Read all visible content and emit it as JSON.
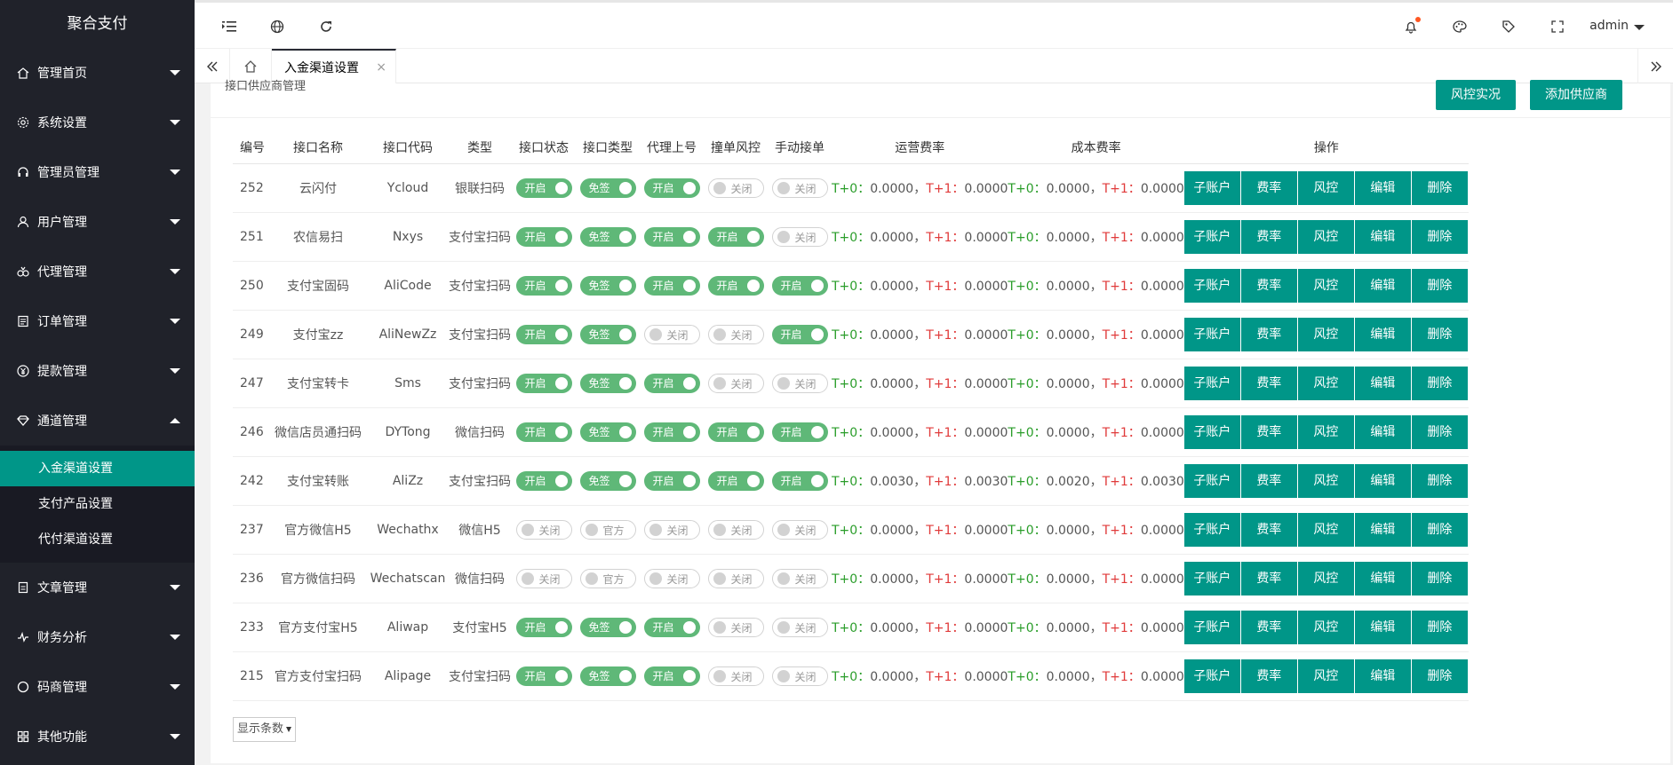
{
  "app": {
    "title": "聚合支付"
  },
  "sidebar": {
    "items": [
      {
        "label": "管理首页",
        "icon": "home-icon"
      },
      {
        "label": "系统设置",
        "icon": "gear-icon"
      },
      {
        "label": "管理员管理",
        "icon": "headset-icon"
      },
      {
        "label": "用户管理",
        "icon": "user-icon"
      },
      {
        "label": "代理管理",
        "icon": "agent-icon"
      },
      {
        "label": "订单管理",
        "icon": "list-icon"
      },
      {
        "label": "提款管理",
        "icon": "yen-icon"
      },
      {
        "label": "通道管理",
        "icon": "diamond-icon",
        "expanded": true
      }
    ],
    "sub_items": [
      {
        "label": "入金渠道设置",
        "active": true
      },
      {
        "label": "支付产品设置"
      },
      {
        "label": "代付渠道设置"
      }
    ],
    "items_after": [
      {
        "label": "文章管理",
        "icon": "doc-icon"
      },
      {
        "label": "财务分析",
        "icon": "pulse-icon"
      },
      {
        "label": "码商管理",
        "icon": "circle-icon"
      },
      {
        "label": "其他功能",
        "icon": "apps-icon"
      }
    ]
  },
  "header": {
    "user": "admin"
  },
  "tabs": {
    "active": "入金渠道设置",
    "close": "×"
  },
  "panel": {
    "title": "接口供应商管理",
    "risk_button": "风控实况",
    "add_button": "添加供应商"
  },
  "table": {
    "columns": [
      "编号",
      "接口名称",
      "接口代码",
      "类型",
      "接口状态",
      "接口类型",
      "代理上号",
      "撞单风控",
      "手动接单",
      "运营费率",
      "成本费率",
      "操作"
    ],
    "ops": [
      "子账户",
      "费率",
      "风控",
      "编辑",
      "删除"
    ],
    "on_label": "开启",
    "off_label": "关闭",
    "free_label": "免签",
    "official_label": "官方",
    "t0": "T+0：",
    "t1": "T+1：",
    "sep": "，",
    "rows": [
      {
        "id": "252",
        "name": "云闪付",
        "code": "Ycloud",
        "type": "银联扫码",
        "status": true,
        "itype": "免签",
        "agent": true,
        "risk": false,
        "manual": false,
        "op_t0": "0.0000",
        "op_t1": "0.0000",
        "cost_t0": "0.0000",
        "cost_t1": "0.0000"
      },
      {
        "id": "251",
        "name": "农信易扫",
        "code": "Nxys",
        "type": "支付宝扫码",
        "status": true,
        "itype": "免签",
        "agent": true,
        "risk": true,
        "manual": false,
        "op_t0": "0.0000",
        "op_t1": "0.0000",
        "cost_t0": "0.0000",
        "cost_t1": "0.0000"
      },
      {
        "id": "250",
        "name": "支付宝固码",
        "code": "AliCode",
        "type": "支付宝扫码",
        "status": true,
        "itype": "免签",
        "agent": true,
        "risk": true,
        "manual": true,
        "op_t0": "0.0000",
        "op_t1": "0.0000",
        "cost_t0": "0.0000",
        "cost_t1": "0.0000"
      },
      {
        "id": "249",
        "name": "支付宝zz",
        "code": "AliNewZz",
        "type": "支付宝扫码",
        "status": true,
        "itype": "免签",
        "agent": false,
        "risk": false,
        "manual": true,
        "op_t0": "0.0000",
        "op_t1": "0.0000",
        "cost_t0": "0.0000",
        "cost_t1": "0.0000"
      },
      {
        "id": "247",
        "name": "支付宝转卡",
        "code": "Sms",
        "type": "支付宝扫码",
        "status": true,
        "itype": "免签",
        "agent": true,
        "risk": false,
        "manual": false,
        "op_t0": "0.0000",
        "op_t1": "0.0000",
        "cost_t0": "0.0000",
        "cost_t1": "0.0000"
      },
      {
        "id": "246",
        "name": "微信店员通扫码",
        "code": "DYTong",
        "type": "微信扫码",
        "status": true,
        "itype": "免签",
        "agent": true,
        "risk": true,
        "manual": true,
        "op_t0": "0.0000",
        "op_t1": "0.0000",
        "cost_t0": "0.0000",
        "cost_t1": "0.0000"
      },
      {
        "id": "242",
        "name": "支付宝转账",
        "code": "AliZz",
        "type": "支付宝扫码",
        "status": true,
        "itype": "免签",
        "agent": true,
        "risk": true,
        "manual": true,
        "op_t0": "0.0030",
        "op_t1": "0.0030",
        "cost_t0": "0.0020",
        "cost_t1": "0.0030"
      },
      {
        "id": "237",
        "name": "官方微信H5",
        "code": "Wechathx",
        "type": "微信H5",
        "status": false,
        "itype": "官方",
        "agent": false,
        "risk": false,
        "manual": false,
        "op_t0": "0.0000",
        "op_t1": "0.0000",
        "cost_t0": "0.0000",
        "cost_t1": "0.0000"
      },
      {
        "id": "236",
        "name": "官方微信扫码",
        "code": "Wechatscan",
        "type": "微信扫码",
        "status": false,
        "itype": "官方",
        "agent": false,
        "risk": false,
        "manual": false,
        "op_t0": "0.0000",
        "op_t1": "0.0000",
        "cost_t0": "0.0000",
        "cost_t1": "0.0000"
      },
      {
        "id": "233",
        "name": "官方支付宝H5",
        "code": "Aliwap",
        "type": "支付宝H5",
        "status": true,
        "itype": "免签",
        "agent": true,
        "risk": false,
        "manual": false,
        "op_t0": "0.0000",
        "op_t1": "0.0000",
        "cost_t0": "0.0000",
        "cost_t1": "0.0000"
      },
      {
        "id": "215",
        "name": "官方支付宝扫码",
        "code": "Alipage",
        "type": "支付宝扫码",
        "status": true,
        "itype": "免签",
        "agent": true,
        "risk": false,
        "manual": false,
        "op_t0": "0.0000",
        "op_t1": "0.0000",
        "cost_t0": "0.0000",
        "cost_t1": "0.0000"
      }
    ]
  },
  "pager": {
    "label": "显示条数"
  },
  "colors": {
    "accent": "#009688",
    "switch_on": "#5fb878",
    "sidebar_bg": "#20222a",
    "green_text": "#2a9d2a",
    "red_text": "#e03a3a"
  }
}
